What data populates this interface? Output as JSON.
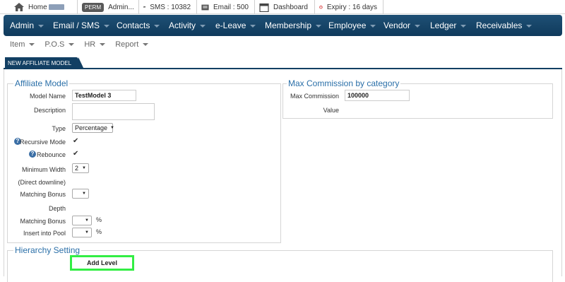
{
  "topbar": {
    "home_label": "Home",
    "perm_badge": "PERM",
    "admin_label": "Admin...",
    "sms_label": "SMS : 10382",
    "email_label": "Email : 500",
    "dashboard_label": "Dashboard",
    "expiry_label": "Expiry : 16 days"
  },
  "mainnav": {
    "items": [
      {
        "label": "Admin"
      },
      {
        "label": "Email / SMS"
      },
      {
        "label": "Contacts"
      },
      {
        "label": "Activity"
      },
      {
        "label": "e-Leave"
      },
      {
        "label": "Membership"
      },
      {
        "label": "Employee"
      },
      {
        "label": "Vendor"
      },
      {
        "label": "Ledger"
      },
      {
        "label": "Receivables"
      }
    ]
  },
  "subnav": {
    "items": [
      {
        "label": "Item"
      },
      {
        "label": "P.O.S"
      },
      {
        "label": "HR"
      },
      {
        "label": "Report"
      }
    ]
  },
  "tab": {
    "label": "NEW AFFILIATE MODEL"
  },
  "affiliate": {
    "legend": "Affiliate Model",
    "model_name_label": "Model Name",
    "model_name_value": "TestModel 3",
    "description_label": "Description",
    "type_label": "Type",
    "type_value": "Percentage",
    "recursive_label": "Recursive Mode",
    "rebounce_label": "Rebounce",
    "min_width_label": "Minimum Width",
    "min_width_value": "2",
    "direct_downline_label": "(Direct downline)",
    "matching_bonus_label": "Matching Bonus",
    "depth_label": "Depth",
    "matching_bonus2_label": "Matching Bonus",
    "insert_pool_label": "Insert into Pool",
    "percent_sign": "%",
    "help_glyph": "?",
    "check_glyph": "✔"
  },
  "maxcomm": {
    "legend": "Max Commission by category",
    "max_comm_label": "Max Commission",
    "max_comm_value": "100000",
    "value_label": "Value"
  },
  "hierarchy": {
    "legend": "Hierarchy Setting",
    "add_level_label": "Add Level"
  },
  "colors": {
    "nav_bg": "#123f63",
    "legend_text": "#2a6fa8",
    "highlight": "#33ee44"
  }
}
